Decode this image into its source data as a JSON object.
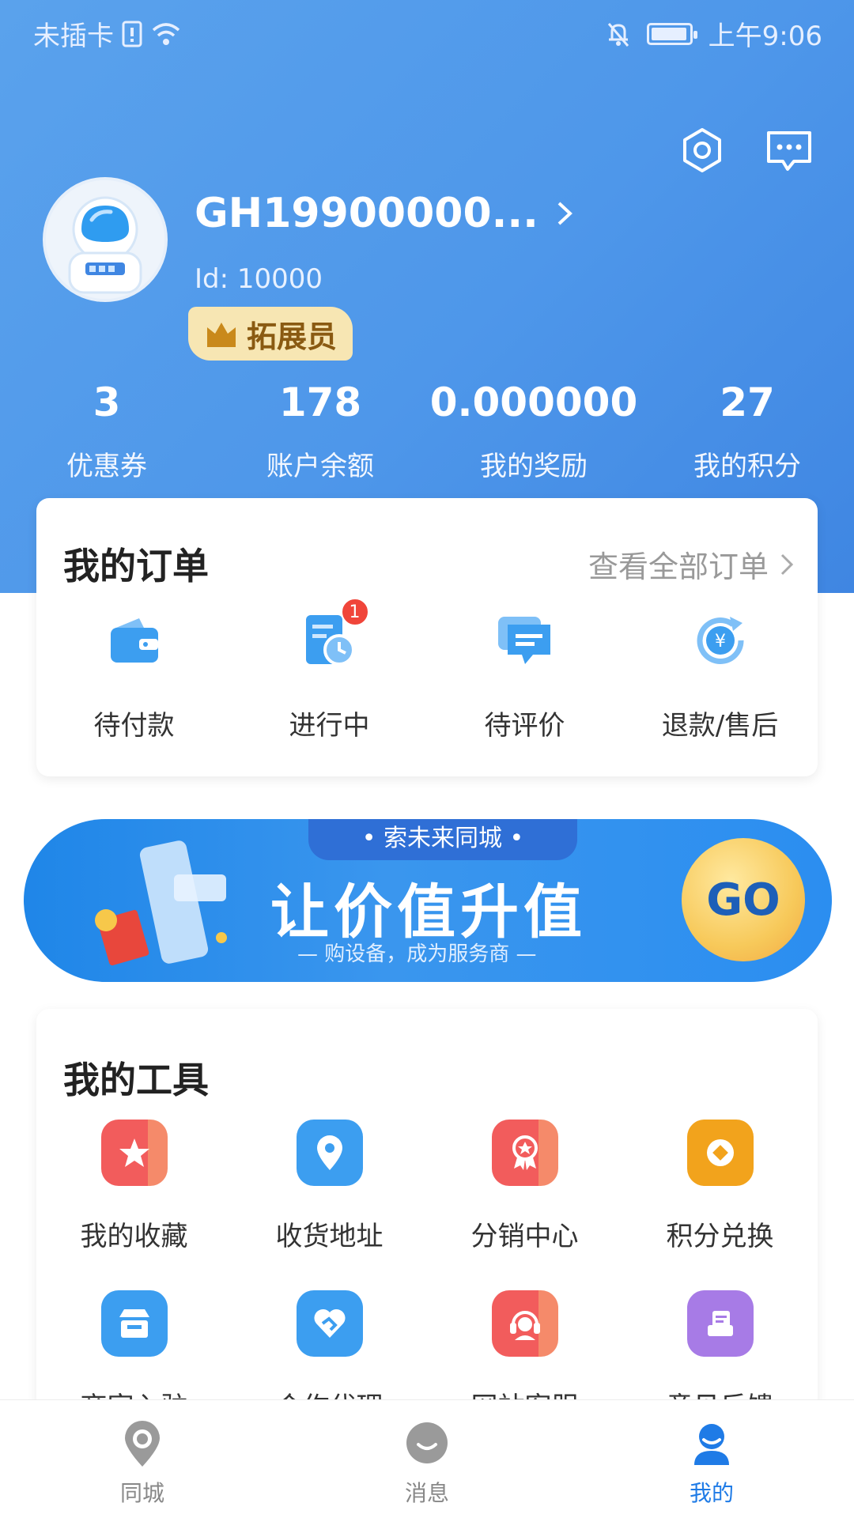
{
  "status_bar": {
    "carrier": "未插卡",
    "time": "上午9:06"
  },
  "profile": {
    "username": "GH19900000...",
    "id_text": "Id: 10000",
    "badge": "拓展员"
  },
  "stats": [
    {
      "value": "3",
      "label": "优惠券"
    },
    {
      "value": "178",
      "label": "账户余额"
    },
    {
      "value": "0.000000",
      "label": "我的奖励"
    },
    {
      "value": "27",
      "label": "我的积分"
    }
  ],
  "orders": {
    "title": "我的订单",
    "view_all": "查看全部订单",
    "items": [
      {
        "label": "待付款",
        "icon": "wallet-icon"
      },
      {
        "label": "进行中",
        "icon": "clock-doc-icon",
        "badge": "1"
      },
      {
        "label": "待评价",
        "icon": "message-icon"
      },
      {
        "label": "退款/售后",
        "icon": "refund-icon"
      }
    ]
  },
  "banner": {
    "tag": "• 索未来同城 •",
    "title": "让价值升值",
    "subtitle": "— 购设备，成为服务商 —",
    "go": "GO"
  },
  "tools": {
    "title": "我的工具",
    "items": [
      {
        "label": "我的收藏",
        "icon": "star-icon",
        "color": "#f25c5c"
      },
      {
        "label": "收货地址",
        "icon": "location-icon",
        "color": "#3c9ef0"
      },
      {
        "label": "分销中心",
        "icon": "award-icon",
        "color": "#f25c5c"
      },
      {
        "label": "积分兑换",
        "icon": "coin-icon",
        "color": "#f2a31c"
      },
      {
        "label": "商家入驻",
        "icon": "shop-icon",
        "color": "#3c9ef0"
      },
      {
        "label": "合作代理",
        "icon": "handshake-icon",
        "color": "#3c9ef0"
      },
      {
        "label": "网站客服",
        "icon": "headset-icon",
        "color": "#f25c5c"
      },
      {
        "label": "意见反馈",
        "icon": "feedback-icon",
        "color": "#a77be6"
      }
    ]
  },
  "tabbar": [
    {
      "label": "同城",
      "icon": "map-pin-icon",
      "active": false
    },
    {
      "label": "消息",
      "icon": "chat-bubble-icon",
      "active": false
    },
    {
      "label": "我的",
      "icon": "user-icon",
      "active": true
    }
  ],
  "colors": {
    "brand_blue": "#4e97ea",
    "active_tab": "#1f7be6",
    "badge_red": "#f0453a"
  }
}
